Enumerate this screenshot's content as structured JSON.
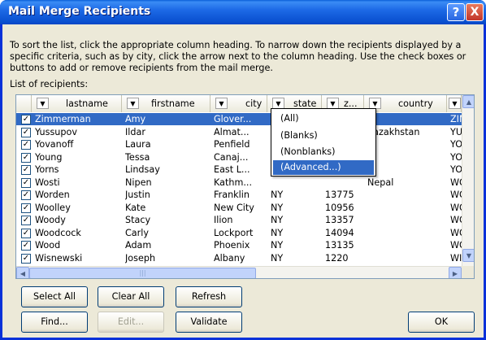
{
  "window": {
    "title": "Mail Merge Recipients",
    "help": "?",
    "close": "X"
  },
  "description": "To sort the list, click the appropriate column heading.  To narrow down the recipients displayed by a specific criteria, such as by city, click the arrow next to the column heading.  Use the check boxes or buttons to add or remove recipients from the mail merge.",
  "list_label": "List of recipients:",
  "columns": [
    "lastname",
    "firstname",
    "city",
    "state",
    "z...",
    "country",
    ""
  ],
  "rows": [
    {
      "lastname": "Zimmerman",
      "firstname": "Amy",
      "city": "Glover...",
      "state": "",
      "zip": "",
      "country": "",
      "extra": "ZIM",
      "checked": "✓",
      "selected": true
    },
    {
      "lastname": "Yussupov",
      "firstname": "Ildar",
      "city": "Almat...",
      "state": "",
      "zip": "",
      "country": "Kazakhstan",
      "extra": "YUS",
      "checked": "✓"
    },
    {
      "lastname": "Yovanoff",
      "firstname": "Laura",
      "city": "Penfield",
      "state": "",
      "zip": "",
      "country": "",
      "extra": "YOV",
      "checked": "✓"
    },
    {
      "lastname": "Young",
      "firstname": "Tessa",
      "city": "Canaj...",
      "state": "",
      "zip": "",
      "country": "",
      "extra": "YOU",
      "checked": "✓"
    },
    {
      "lastname": "Yorns",
      "firstname": "Lindsay",
      "city": "East L...",
      "state": "",
      "zip": "",
      "country": "",
      "extra": "YOR",
      "checked": "✓"
    },
    {
      "lastname": "Wosti",
      "firstname": "Nipen",
      "city": "Kathm...",
      "state": "",
      "zip": "",
      "country": "Nepal",
      "extra": "WOS",
      "checked": "✓"
    },
    {
      "lastname": "Worden",
      "firstname": "Justin",
      "city": "Franklin",
      "state": "NY",
      "zip": "13775",
      "country": "",
      "extra": "WOF",
      "checked": "✓"
    },
    {
      "lastname": "Woolley",
      "firstname": "Kate",
      "city": "New City",
      "state": "NY",
      "zip": "10956",
      "country": "",
      "extra": "WOO",
      "checked": "✓"
    },
    {
      "lastname": "Woody",
      "firstname": "Stacy",
      "city": "Ilion",
      "state": "NY",
      "zip": "13357",
      "country": "",
      "extra": "WOO",
      "checked": "✓"
    },
    {
      "lastname": "Woodcock",
      "firstname": "Carly",
      "city": "Lockport",
      "state": "NY",
      "zip": "14094",
      "country": "",
      "extra": "WOO",
      "checked": "✓"
    },
    {
      "lastname": "Wood",
      "firstname": "Adam",
      "city": "Phoenix",
      "state": "NY",
      "zip": "13135",
      "country": "",
      "extra": "WOO",
      "checked": "✓"
    },
    {
      "lastname": "Wisnewski",
      "firstname": "Joseph",
      "city": "Albany",
      "state": "NY",
      "zip": "1220",
      "country": "",
      "extra": "WIS",
      "checked": "✓"
    }
  ],
  "filter_menu": [
    "(All)",
    "(Blanks)",
    "(Nonblanks)",
    "(Advanced...)"
  ],
  "buttons": {
    "select_all": "Select All",
    "clear_all": "Clear All",
    "refresh": "Refresh",
    "find": "Find...",
    "edit": "Edit...",
    "validate": "Validate",
    "ok": "OK"
  },
  "colors": {
    "title_bar": "#0a50d0",
    "selection": "#316ac5",
    "dialog_bg": "#ece9d8"
  }
}
